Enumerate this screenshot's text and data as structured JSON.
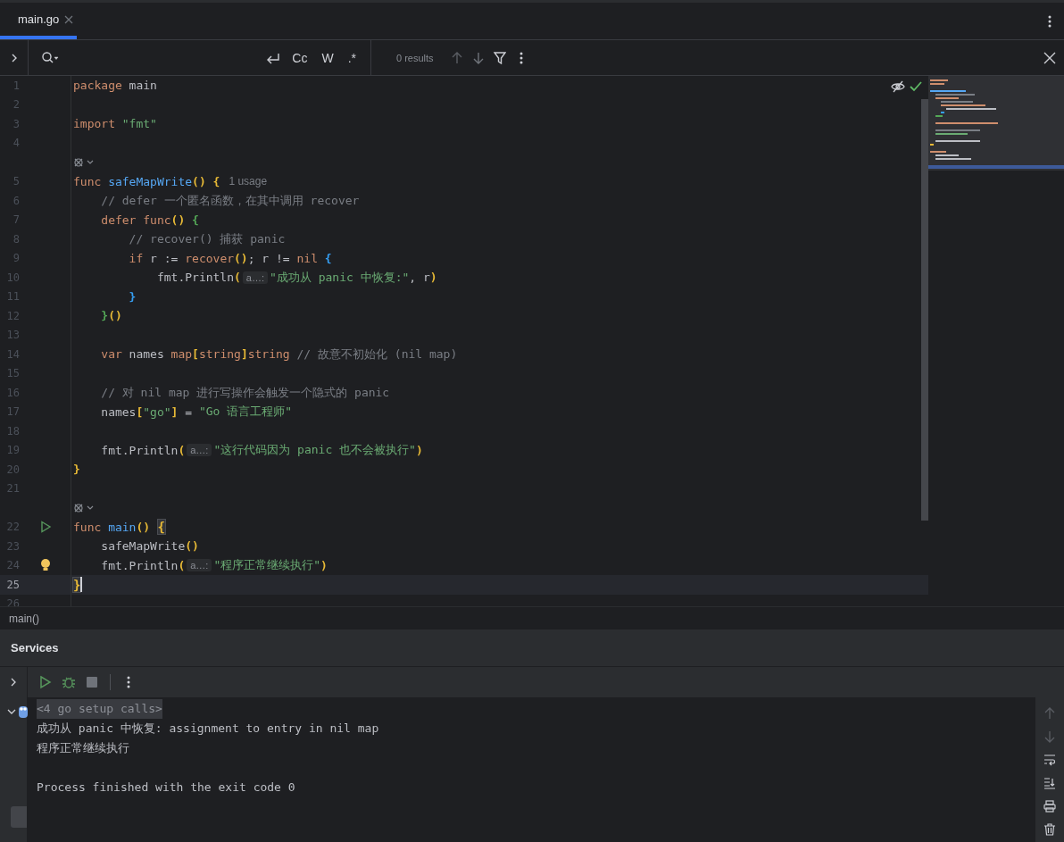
{
  "tab": {
    "label": "main.go",
    "selected": true
  },
  "find_bar": {
    "options": [
      "Cc",
      "W",
      ".*"
    ],
    "results": "0 results"
  },
  "editor": {
    "lines": [
      {
        "kind": "code",
        "number": "1",
        "current": false,
        "tokens": [
          {
            "kind": "keyword",
            "text": "package"
          },
          {
            "kind": "text",
            "text": " main"
          }
        ]
      },
      {
        "kind": "code",
        "number": "2",
        "current": false
      },
      {
        "kind": "code",
        "number": "3",
        "current": false,
        "tokens": [
          {
            "kind": "keyword",
            "text": "import"
          },
          {
            "kind": "string",
            "text": " \"fmt\""
          }
        ]
      },
      {
        "kind": "code",
        "number": "4",
        "current": false
      },
      {
        "kind": "hint"
      },
      {
        "kind": "code",
        "number": "5",
        "current": false,
        "tokens": [
          {
            "kind": "keyword",
            "text": "func"
          },
          {
            "kind": "function",
            "text": " safeMapWrite"
          },
          {
            "kind": "bracket",
            "color": "#e8ba36",
            "text": "()"
          },
          {
            "kind": "bracket",
            "color": "#e8ba36",
            "text": " {"
          },
          {
            "kind": "usage",
            "text": "1 usage"
          }
        ]
      },
      {
        "kind": "code",
        "number": "6",
        "current": false,
        "tokens": [
          {
            "kind": "comment",
            "text": "    // defer 一个匿名函数，在其中调用 recover"
          }
        ]
      },
      {
        "kind": "code",
        "number": "7",
        "current": false,
        "tokens": [
          {
            "kind": "keyword",
            "text": "    defer"
          },
          {
            "kind": "keyword",
            "text": " func"
          },
          {
            "kind": "bracket",
            "color": "#e8ba36",
            "text": "()"
          },
          {
            "kind": "bracket",
            "color": "#54a857",
            "text": " {"
          }
        ]
      },
      {
        "kind": "code",
        "number": "8",
        "current": false,
        "tokens": [
          {
            "kind": "comment",
            "text": "        // recover() 捕获 panic"
          }
        ]
      },
      {
        "kind": "code",
        "number": "9",
        "current": false,
        "tokens": [
          {
            "kind": "keyword",
            "text": "        if"
          },
          {
            "kind": "text",
            "text": " r := "
          },
          {
            "kind": "builtin",
            "text": "recover"
          },
          {
            "kind": "bracket",
            "color": "#e8ba36",
            "text": "()"
          },
          {
            "kind": "text",
            "text": "; r != "
          },
          {
            "kind": "keyword",
            "text": "nil"
          },
          {
            "kind": "bracket",
            "color": "#359ff4",
            "text": " {"
          }
        ]
      },
      {
        "kind": "code",
        "number": "10",
        "current": false,
        "tokens": [
          {
            "kind": "text",
            "text": "            fmt.Println"
          },
          {
            "kind": "bracket",
            "color": "#e8ba36",
            "text": "("
          },
          {
            "kind": "inlay",
            "text": "a…:"
          },
          {
            "kind": "string",
            "text": "\"成功从 panic 中恢复:\""
          },
          {
            "kind": "text",
            "text": ", r"
          },
          {
            "kind": "bracket",
            "color": "#e8ba36",
            "text": ")"
          }
        ]
      },
      {
        "kind": "code",
        "number": "11",
        "current": false,
        "tokens": [
          {
            "kind": "bracket",
            "color": "#359ff4",
            "text": "        }"
          }
        ]
      },
      {
        "kind": "code",
        "number": "12",
        "current": false,
        "tokens": [
          {
            "kind": "bracket",
            "color": "#54a857",
            "text": "    }"
          },
          {
            "kind": "bracket",
            "color": "#e8ba36",
            "text": "()"
          }
        ]
      },
      {
        "kind": "code",
        "number": "13",
        "current": false
      },
      {
        "kind": "code",
        "number": "14",
        "current": false,
        "tokens": [
          {
            "kind": "keyword",
            "text": "    var"
          },
          {
            "kind": "text",
            "text": " names "
          },
          {
            "kind": "keyword",
            "text": "map"
          },
          {
            "kind": "bracket",
            "color": "#e8ba36",
            "text": "["
          },
          {
            "kind": "keyword",
            "text": "string"
          },
          {
            "kind": "bracket",
            "color": "#e8ba36",
            "text": "]"
          },
          {
            "kind": "keyword",
            "text": "string"
          },
          {
            "kind": "comment",
            "text": " // 故意不初始化 (nil map)"
          }
        ]
      },
      {
        "kind": "code",
        "number": "15",
        "current": false
      },
      {
        "kind": "code",
        "number": "16",
        "current": false,
        "tokens": [
          {
            "kind": "comment",
            "text": "    // 对 nil map 进行写操作会触发一个隐式的 panic"
          }
        ]
      },
      {
        "kind": "code",
        "number": "17",
        "current": false,
        "tokens": [
          {
            "kind": "text",
            "text": "    names"
          },
          {
            "kind": "bracket",
            "color": "#e8ba36",
            "text": "["
          },
          {
            "kind": "string",
            "text": "\"go\""
          },
          {
            "kind": "bracket",
            "color": "#e8ba36",
            "text": "]"
          },
          {
            "kind": "text",
            "text": " = "
          },
          {
            "kind": "string",
            "text": "\"Go 语言工程师\""
          }
        ]
      },
      {
        "kind": "code",
        "number": "18",
        "current": false
      },
      {
        "kind": "code",
        "number": "19",
        "current": false,
        "tokens": [
          {
            "kind": "text",
            "text": "    fmt.Println"
          },
          {
            "kind": "bracket",
            "color": "#e8ba36",
            "text": "("
          },
          {
            "kind": "inlay",
            "text": "a…:"
          },
          {
            "kind": "string",
            "text": "\"这行代码因为 panic 也不会被执行\""
          },
          {
            "kind": "bracket",
            "color": "#e8ba36",
            "text": ")"
          }
        ]
      },
      {
        "kind": "code",
        "number": "20",
        "current": false,
        "tokens": [
          {
            "kind": "bracket",
            "color": "#e8ba36",
            "text": "}"
          }
        ]
      },
      {
        "kind": "code",
        "number": "21",
        "current": false
      },
      {
        "kind": "hint"
      },
      {
        "kind": "code",
        "number": "22",
        "current": false,
        "gutter": {
          "kind": "run"
        },
        "tokens": [
          {
            "kind": "keyword",
            "text": "func"
          },
          {
            "kind": "function",
            "text": " main"
          },
          {
            "kind": "bracket",
            "color": "#e8ba36",
            "text": "()"
          },
          {
            "kind": "matched",
            "color": "#e8ba36",
            "text": "{"
          }
        ]
      },
      {
        "kind": "code",
        "number": "23",
        "current": false,
        "tokens": [
          {
            "kind": "text",
            "text": "    safeMapWrite"
          },
          {
            "kind": "bracket",
            "color": "#e8ba36",
            "text": "()"
          }
        ]
      },
      {
        "kind": "code",
        "number": "24",
        "current": false,
        "gutter": {
          "kind": "bulb"
        },
        "tokens": [
          {
            "kind": "text",
            "text": "    fmt.Println"
          },
          {
            "kind": "bracket",
            "color": "#e8ba36",
            "text": "("
          },
          {
            "kind": "inlay",
            "text": "a…:"
          },
          {
            "kind": "string",
            "text": "\"程序正常继续执行\""
          },
          {
            "kind": "bracket",
            "color": "#e8ba36",
            "text": ")"
          }
        ]
      },
      {
        "kind": "code",
        "number": "25",
        "current": true,
        "tokens": [
          {
            "kind": "matched",
            "color": "#e8ba36",
            "text": "}"
          }
        ]
      },
      {
        "kind": "code",
        "number": "26",
        "current": false
      }
    ]
  },
  "breadcrumb": "main()",
  "services": {
    "title": "Services",
    "console": [
      {
        "kind": "folded",
        "text": "<4 go setup calls>"
      },
      {
        "kind": "output",
        "text": "成功从 panic 中恢复: assignment to entry in nil map"
      },
      {
        "kind": "output",
        "text": "程序正常继续执行"
      },
      {
        "kind": "status",
        "text": "Process finished with the exit code 0"
      }
    ]
  }
}
